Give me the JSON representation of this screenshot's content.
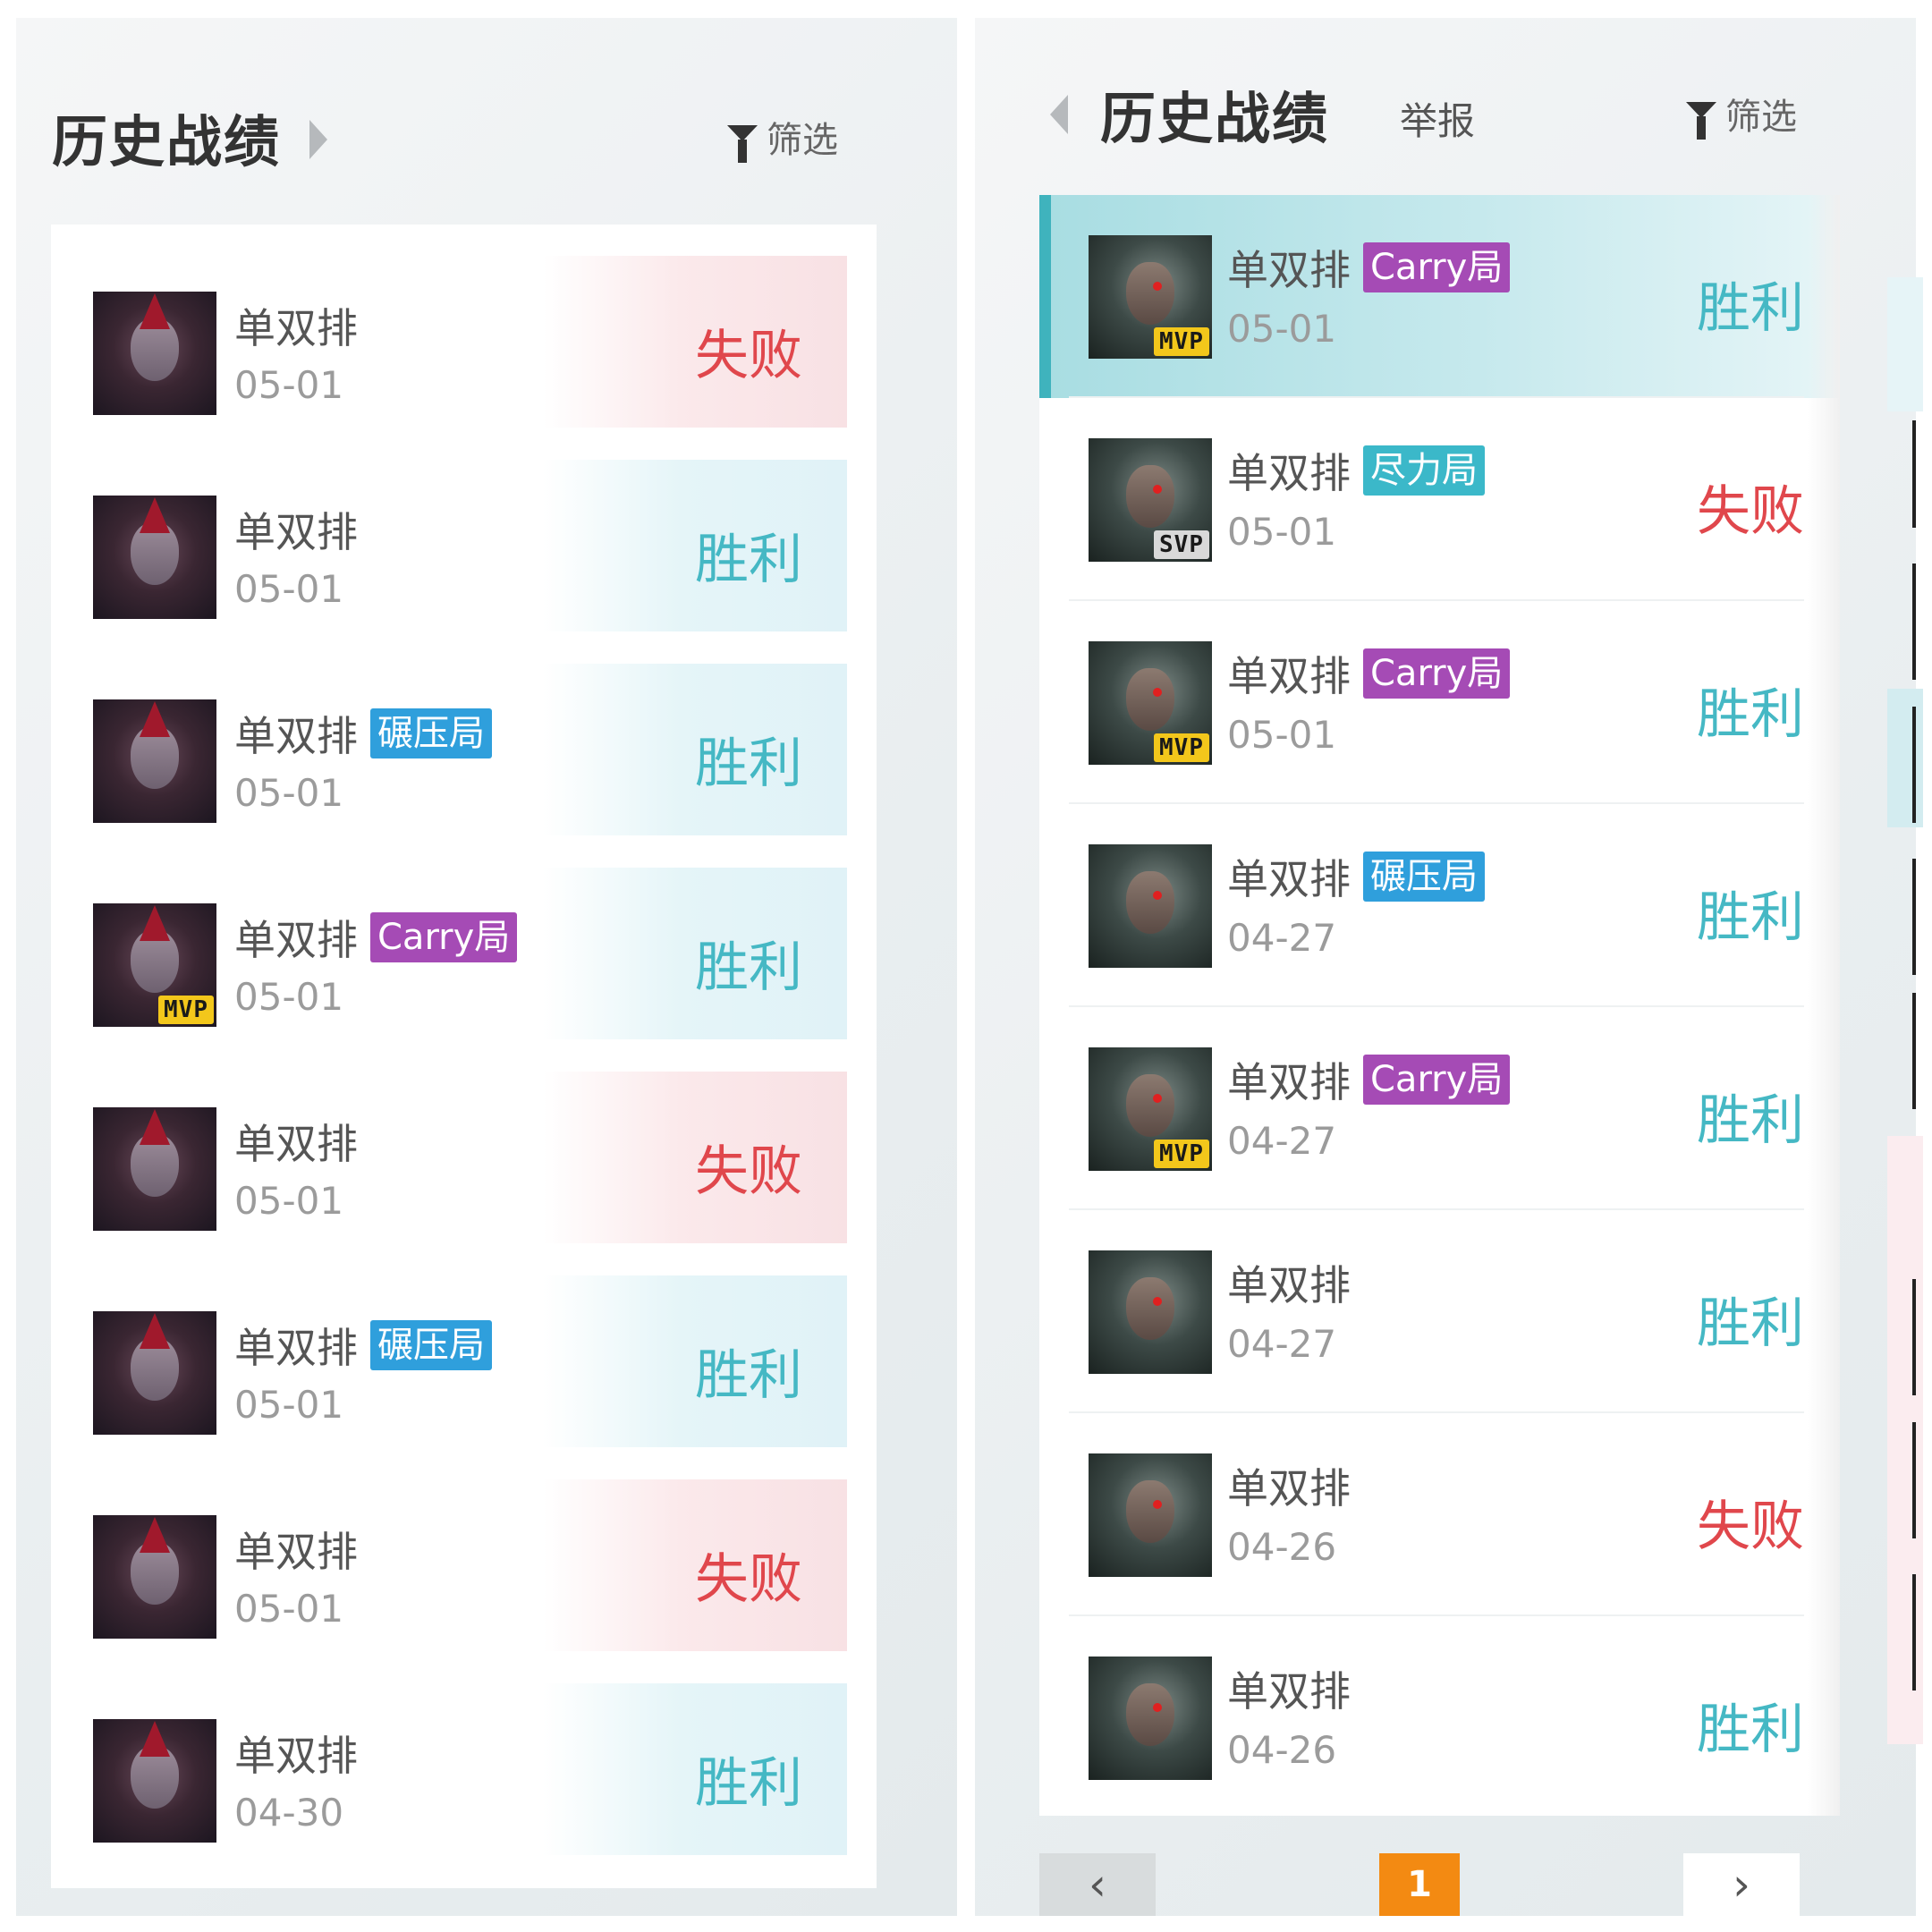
{
  "left_panel": {
    "title": "历史战绩",
    "filter_label": "筛选",
    "matches": [
      {
        "mode": "单双排",
        "tag": "",
        "date": "05-01",
        "result": "失败",
        "outcome": "loss",
        "badge": ""
      },
      {
        "mode": "单双排",
        "tag": "",
        "date": "05-01",
        "result": "胜利",
        "outcome": "win",
        "badge": ""
      },
      {
        "mode": "单双排",
        "tag": "碾压局",
        "date": "05-01",
        "result": "胜利",
        "outcome": "win",
        "badge": ""
      },
      {
        "mode": "单双排",
        "tag": "Carry局",
        "date": "05-01",
        "result": "胜利",
        "outcome": "win",
        "badge": "MVP"
      },
      {
        "mode": "单双排",
        "tag": "",
        "date": "05-01",
        "result": "失败",
        "outcome": "loss",
        "badge": ""
      },
      {
        "mode": "单双排",
        "tag": "碾压局",
        "date": "05-01",
        "result": "胜利",
        "outcome": "win",
        "badge": ""
      },
      {
        "mode": "单双排",
        "tag": "",
        "date": "05-01",
        "result": "失败",
        "outcome": "loss",
        "badge": ""
      },
      {
        "mode": "单双排",
        "tag": "",
        "date": "04-30",
        "result": "胜利",
        "outcome": "win",
        "badge": ""
      }
    ]
  },
  "right_panel": {
    "title": "历史战绩",
    "report_label": "举报",
    "filter_label": "筛选",
    "matches": [
      {
        "mode": "单双排",
        "tag": "Carry局",
        "date": "05-01",
        "result": "胜利",
        "outcome": "win",
        "badge": "MVP",
        "selected": true
      },
      {
        "mode": "单双排",
        "tag": "尽力局",
        "date": "05-01",
        "result": "失败",
        "outcome": "loss",
        "badge": "SVP"
      },
      {
        "mode": "单双排",
        "tag": "Carry局",
        "date": "05-01",
        "result": "胜利",
        "outcome": "win",
        "badge": "MVP"
      },
      {
        "mode": "单双排",
        "tag": "碾压局",
        "date": "04-27",
        "result": "胜利",
        "outcome": "win",
        "badge": ""
      },
      {
        "mode": "单双排",
        "tag": "Carry局",
        "date": "04-27",
        "result": "胜利",
        "outcome": "win",
        "badge": "MVP"
      },
      {
        "mode": "单双排",
        "tag": "",
        "date": "04-27",
        "result": "胜利",
        "outcome": "win",
        "badge": ""
      },
      {
        "mode": "单双排",
        "tag": "",
        "date": "04-26",
        "result": "失败",
        "outcome": "loss",
        "badge": ""
      },
      {
        "mode": "单双排",
        "tag": "",
        "date": "04-26",
        "result": "胜利",
        "outcome": "win",
        "badge": ""
      }
    ],
    "pagination": {
      "prev": "‹",
      "current_page": "1",
      "next": "›"
    }
  },
  "tag_colors": {
    "Carry局": "#a54bb5",
    "碾压局": "#2f9fdc",
    "尽力局": "#3bb8c9"
  },
  "result_colors": {
    "win": "#45b8c4",
    "loss": "#e0474c"
  },
  "accent_color": "#3fb3bd",
  "icons": {
    "filter": "funnel-icon",
    "expand": "caret-right-icon",
    "collapse": "caret-left-icon"
  }
}
